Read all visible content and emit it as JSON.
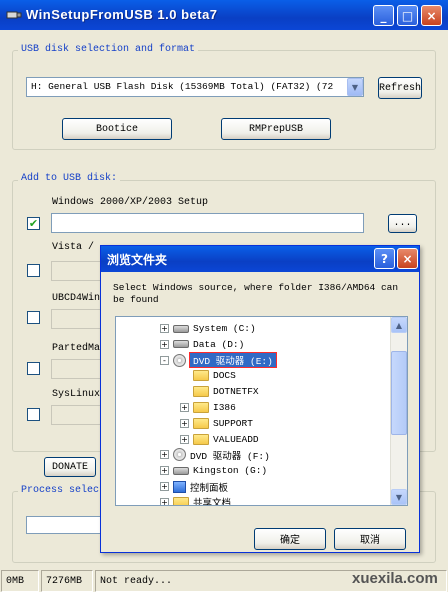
{
  "window": {
    "title": "WinSetupFromUSB 1.0 beta7",
    "minimize": "_",
    "maximize": "□",
    "close": "×"
  },
  "usb_group": {
    "label": "USB disk selection and format",
    "disk_value": "H: General USB Flash Disk (15369MB Total) (FAT32) (72",
    "refresh_label": "Refresh",
    "bootice_label": "Bootice",
    "rmprep_label": "RMPrepUSB"
  },
  "add_group": {
    "label": "Add to USB disk:",
    "win2000_label": "Windows 2000/XP/2003 Setup",
    "win2000_checked": true,
    "browse_label": "...",
    "vista_label": "Vista / ",
    "ubcd_label": "UBCD4Win",
    "parted_label": "PartedMa",
    "syslinux_label": "SysLinux"
  },
  "donate_label": "DONATE",
  "process_label": "Process selec",
  "status": {
    "left": "0MB",
    "size": "7276MB",
    "text": "Not ready..."
  },
  "dialog": {
    "title": "浏览文件夹",
    "help": "?",
    "close": "×",
    "prompt": "Select Windows source, where folder I386/AMD64 can be found",
    "ok_label": "确定",
    "cancel_label": "取消",
    "tree": [
      {
        "label": "System (C:)",
        "icon": "hard-drive-icon",
        "expander": "+",
        "level": 0
      },
      {
        "label": "Data (D:)",
        "icon": "hard-drive-icon",
        "expander": "+",
        "level": 0
      },
      {
        "label": "DVD 驱动器 (E:)",
        "icon": "cd-drive-icon",
        "expander": "-",
        "level": 0,
        "selected": true
      },
      {
        "label": "DOCS",
        "icon": "folder-icon",
        "expander": "",
        "level": 1
      },
      {
        "label": "DOTNETFX",
        "icon": "folder-icon",
        "expander": "",
        "level": 1
      },
      {
        "label": "I386",
        "icon": "folder-icon",
        "expander": "+",
        "level": 1
      },
      {
        "label": "SUPPORT",
        "icon": "folder-icon",
        "expander": "+",
        "level": 1
      },
      {
        "label": "VALUEADD",
        "icon": "folder-icon",
        "expander": "+",
        "level": 1
      },
      {
        "label": "DVD 驱动器 (F:)",
        "icon": "cd-drive-icon",
        "expander": "+",
        "level": 0
      },
      {
        "label": "Kingston (G:)",
        "icon": "usb-drive-icon",
        "expander": "+",
        "level": 0
      },
      {
        "label": "控制面板",
        "icon": "control-panel-icon",
        "expander": "+",
        "level": 0
      },
      {
        "label": "共享文档",
        "icon": "folder-icon",
        "expander": "+",
        "level": 0
      }
    ]
  },
  "watermark": "xuexila.com"
}
